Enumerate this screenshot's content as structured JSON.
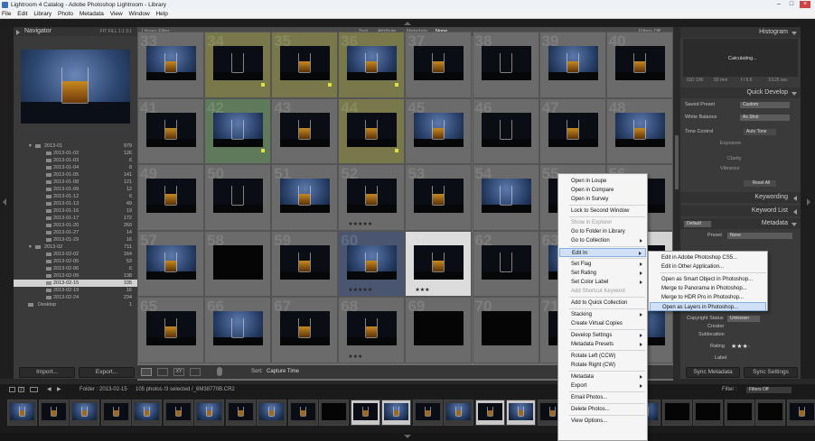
{
  "window": {
    "title": "Lightroom 4 Catalog - Adobe Photoshop Lightroom - Library"
  },
  "menubar": [
    "File",
    "Edit",
    "Library",
    "Photo",
    "Metadata",
    "View",
    "Window",
    "Help"
  ],
  "navigator": {
    "title": "Navigator",
    "zoom_opts": [
      "FIT",
      "FILL",
      "1:1",
      "3:1"
    ]
  },
  "folders": [
    {
      "name": "2013-01",
      "count": "979",
      "level": 0
    },
    {
      "name": "2013-01-02",
      "count": "126",
      "level": 1
    },
    {
      "name": "2013-01-03",
      "count": "6",
      "level": 1
    },
    {
      "name": "2013-01-04",
      "count": "8",
      "level": 1
    },
    {
      "name": "2013-01-05",
      "count": "141",
      "level": 1
    },
    {
      "name": "2013-01-08",
      "count": "121",
      "level": 1
    },
    {
      "name": "2013-01-09",
      "count": "12",
      "level": 1
    },
    {
      "name": "2013-01-12",
      "count": "6",
      "level": 1
    },
    {
      "name": "2013-01-13",
      "count": "49",
      "level": 1
    },
    {
      "name": "2013-01-16",
      "count": "19",
      "level": 1
    },
    {
      "name": "2013-01-17",
      "count": "172",
      "level": 1
    },
    {
      "name": "2013-01-20",
      "count": "260",
      "level": 1
    },
    {
      "name": "2013-01-27",
      "count": "14",
      "level": 1
    },
    {
      "name": "2013-01-29",
      "count": "16",
      "level": 1
    },
    {
      "name": "2013-02",
      "count": "711",
      "level": 0
    },
    {
      "name": "2013-02-02",
      "count": "164",
      "level": 1
    },
    {
      "name": "2013-02-05",
      "count": "53",
      "level": 1
    },
    {
      "name": "2013-02-06",
      "count": "6",
      "level": 1
    },
    {
      "name": "2013-02-09",
      "count": "138",
      "level": 1
    },
    {
      "name": "2013-02-15",
      "count": "105",
      "level": 1,
      "selected": true
    },
    {
      "name": "2013-02-19",
      "count": "16",
      "level": 1
    },
    {
      "name": "2013-02-24",
      "count": "234",
      "level": 1
    },
    {
      "name": "Desktop",
      "count": "1",
      "level": -1
    }
  ],
  "left_buttons": {
    "import": "Import...",
    "export": "Export..."
  },
  "filterbar": {
    "label": "Library Filter :",
    "opts": [
      "Text",
      "Attribute",
      "Metadata",
      "None"
    ],
    "filters_off": "Filters Off"
  },
  "grid_numbers": [
    "33",
    "34",
    "35",
    "36",
    "37",
    "38",
    "39",
    "40",
    "41",
    "42",
    "43",
    "44",
    "45",
    "46",
    "47",
    "48",
    "49",
    "50",
    "51",
    "52",
    "53",
    "54",
    "55",
    "56",
    "57",
    "58",
    "59",
    "60",
    "61",
    "62",
    "63",
    "64",
    "65",
    "66",
    "67",
    "68",
    "69",
    "70",
    "71",
    "72"
  ],
  "toolbar": {
    "sort_label": "Sort:",
    "sort_value": "Capture Time"
  },
  "histogram": {
    "title": "Histogram",
    "status": "Calculating...",
    "info": [
      "ISO 100",
      "50 mm",
      "f / 5.6",
      "1/125 sec"
    ]
  },
  "quick_develop": {
    "title": "Quick Develop",
    "saved_preset_label": "Saved Preset",
    "saved_preset_value": "Custom",
    "white_balance_label": "White Balance",
    "white_balance_value": "As Shot",
    "tone_control_label": "Tone Control",
    "tone_control_value": "Auto Tone",
    "exposure_label": "Exposure",
    "clarity_label": "Clarity",
    "vibrance_label": "Vibrance",
    "reset_label": "Reset All"
  },
  "keywording": {
    "title": "Keywording"
  },
  "keyword_list": {
    "title": "Keyword List"
  },
  "metadata": {
    "title": "Metadata",
    "preset_selector": "Default",
    "preset_label": "Preset",
    "preset_value": "None",
    "copyright_status_label": "Copyright Status",
    "copyright_status_value": "Unknown",
    "creator_label": "Creator",
    "sublocation_label": "Sublocation",
    "rating_label": "Rating",
    "rating_value": "★★★·",
    "label_label": "Label"
  },
  "right_buttons": {
    "sync_metadata": "Sync Metadata",
    "sync_settings": "Sync Settings"
  },
  "filmstrip_bar": {
    "pages": [
      "1",
      "2"
    ],
    "folder": "Folder : 2013-02-15",
    "count": "105 photos /3 selected /_6M38770B.CR2",
    "filter_label": "Filter :",
    "filter_value": "Filters Off"
  },
  "context_menu": {
    "items": [
      {
        "label": "Open in Loupe",
        "disabled": false,
        "submenu": false
      },
      {
        "label": "Open in Compare",
        "disabled": false,
        "submenu": false
      },
      {
        "label": "Open in Survey",
        "disabled": false,
        "submenu": false
      },
      {
        "sep": true
      },
      {
        "label": "Lock to Second Window",
        "disabled": false,
        "submenu": false
      },
      {
        "sep": true
      },
      {
        "label": "Show in Explorer",
        "disabled": true,
        "submenu": false
      },
      {
        "label": "Go to Folder in Library",
        "disabled": false,
        "submenu": false
      },
      {
        "label": "Go to Collection",
        "disabled": false,
        "submenu": true
      },
      {
        "sep": true
      },
      {
        "label": "Edit In",
        "disabled": false,
        "submenu": true,
        "highlight": true
      },
      {
        "sep": true
      },
      {
        "label": "Set Flag",
        "disabled": false,
        "submenu": true
      },
      {
        "label": "Set Rating",
        "disabled": false,
        "submenu": true
      },
      {
        "label": "Set Color Label",
        "disabled": false,
        "submenu": true
      },
      {
        "label": "Add Shortcut Keyword",
        "disabled": true,
        "submenu": false
      },
      {
        "sep": true
      },
      {
        "label": "Add to Quick Collection",
        "disabled": false,
        "submenu": false
      },
      {
        "sep": true
      },
      {
        "label": "Stacking",
        "disabled": false,
        "submenu": true
      },
      {
        "label": "Create Virtual Copies",
        "disabled": false,
        "submenu": false
      },
      {
        "sep": true
      },
      {
        "label": "Develop Settings",
        "disabled": false,
        "submenu": true
      },
      {
        "label": "Metadata Presets",
        "disabled": false,
        "submenu": true
      },
      {
        "sep": true
      },
      {
        "label": "Rotate Left (CCW)",
        "disabled": false,
        "submenu": false
      },
      {
        "label": "Rotate Right (CW)",
        "disabled": false,
        "submenu": false
      },
      {
        "sep": true
      },
      {
        "label": "Metadata",
        "disabled": false,
        "submenu": true
      },
      {
        "label": "Export",
        "disabled": false,
        "submenu": true
      },
      {
        "sep": true
      },
      {
        "label": "Email Photos...",
        "disabled": false,
        "submenu": false
      },
      {
        "sep": true
      },
      {
        "label": "Delete Photos...",
        "disabled": false,
        "submenu": false
      },
      {
        "sep": true
      },
      {
        "label": "View Options...",
        "disabled": false,
        "submenu": false
      }
    ]
  },
  "edit_in_submenu": {
    "items": [
      {
        "label": "Edit in Adobe Photoshop CS5..."
      },
      {
        "label": "Edit in Other Application..."
      },
      {
        "sep": true
      },
      {
        "label": "Open as Smart Object in Photoshop..."
      },
      {
        "label": "Merge to Panorama in Photoshop..."
      },
      {
        "label": "Merge to HDR Pro in Photoshop..."
      },
      {
        "label": "Open as Layers in Photoshop...",
        "highlight": true
      }
    ]
  }
}
